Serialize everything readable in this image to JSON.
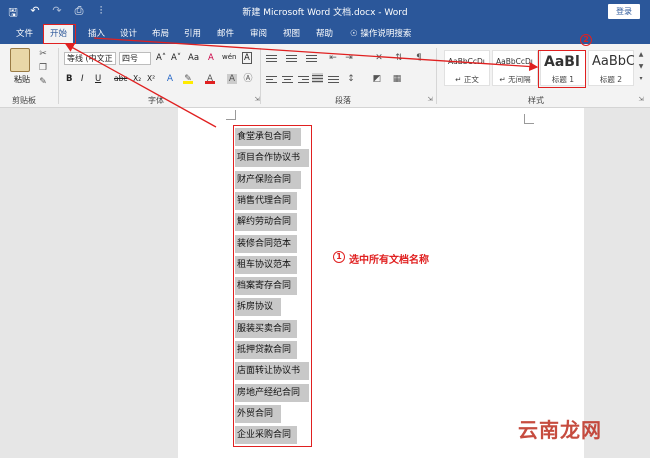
{
  "titlebar": {
    "title": "新建 Microsoft Word 文档.docx - Word",
    "login_label": "登录",
    "qat": [
      "save-icon",
      "undo-icon",
      "redo-icon",
      "print-preview-icon",
      "customize-icon"
    ]
  },
  "tabs": [
    "文件",
    "开始",
    "插入",
    "设计",
    "布局",
    "引用",
    "邮件",
    "审阅",
    "视图",
    "帮助",
    "操作说明搜索"
  ],
  "active_tab": "开始",
  "ribbon": {
    "clipboard": {
      "label": "剪贴板",
      "paste_label": "粘贴"
    },
    "font": {
      "label": "字体",
      "font_name": "等线 (中文正",
      "font_size": "四号",
      "bold": "B",
      "italic": "I",
      "underline": "U",
      "strike": "abc",
      "sub": "X₂",
      "sup": "X²",
      "grow": "A˄",
      "shrink": "A˅",
      "case": "Aa",
      "clear": "A",
      "phonetic": "wén",
      "border": "A"
    },
    "paragraph": {
      "label": "段落"
    },
    "styles": {
      "label": "样式",
      "items": [
        {
          "sample": "AaBbCcDı",
          "name": "↵ 正文"
        },
        {
          "sample": "AaBbCcDı",
          "name": "↵ 无间隔"
        },
        {
          "sample": "AaBl",
          "name": "标题 1"
        },
        {
          "sample": "AaBbC",
          "name": "标题 2"
        }
      ]
    }
  },
  "document": {
    "lines": [
      "食堂承包合同",
      "项目合作协议书",
      "财产保险合同",
      "销售代理合同",
      "解约劳动合同",
      "装修合同范本",
      "租车协议范本",
      "档案寄存合同",
      "拆房协议",
      "服装买卖合同",
      "抵押贷款合同",
      "店面转让协议书",
      "房地产经纪合同",
      "外贸合同",
      "企业采购合同"
    ]
  },
  "annotations": {
    "step1_number": "1",
    "step1_text": "选中所有文档名称",
    "step2_number": "2"
  },
  "watermark": "云南龙网",
  "colors": {
    "brand": "#2b579a",
    "annotation": "#e02020",
    "selection": "#c8c8c8"
  }
}
